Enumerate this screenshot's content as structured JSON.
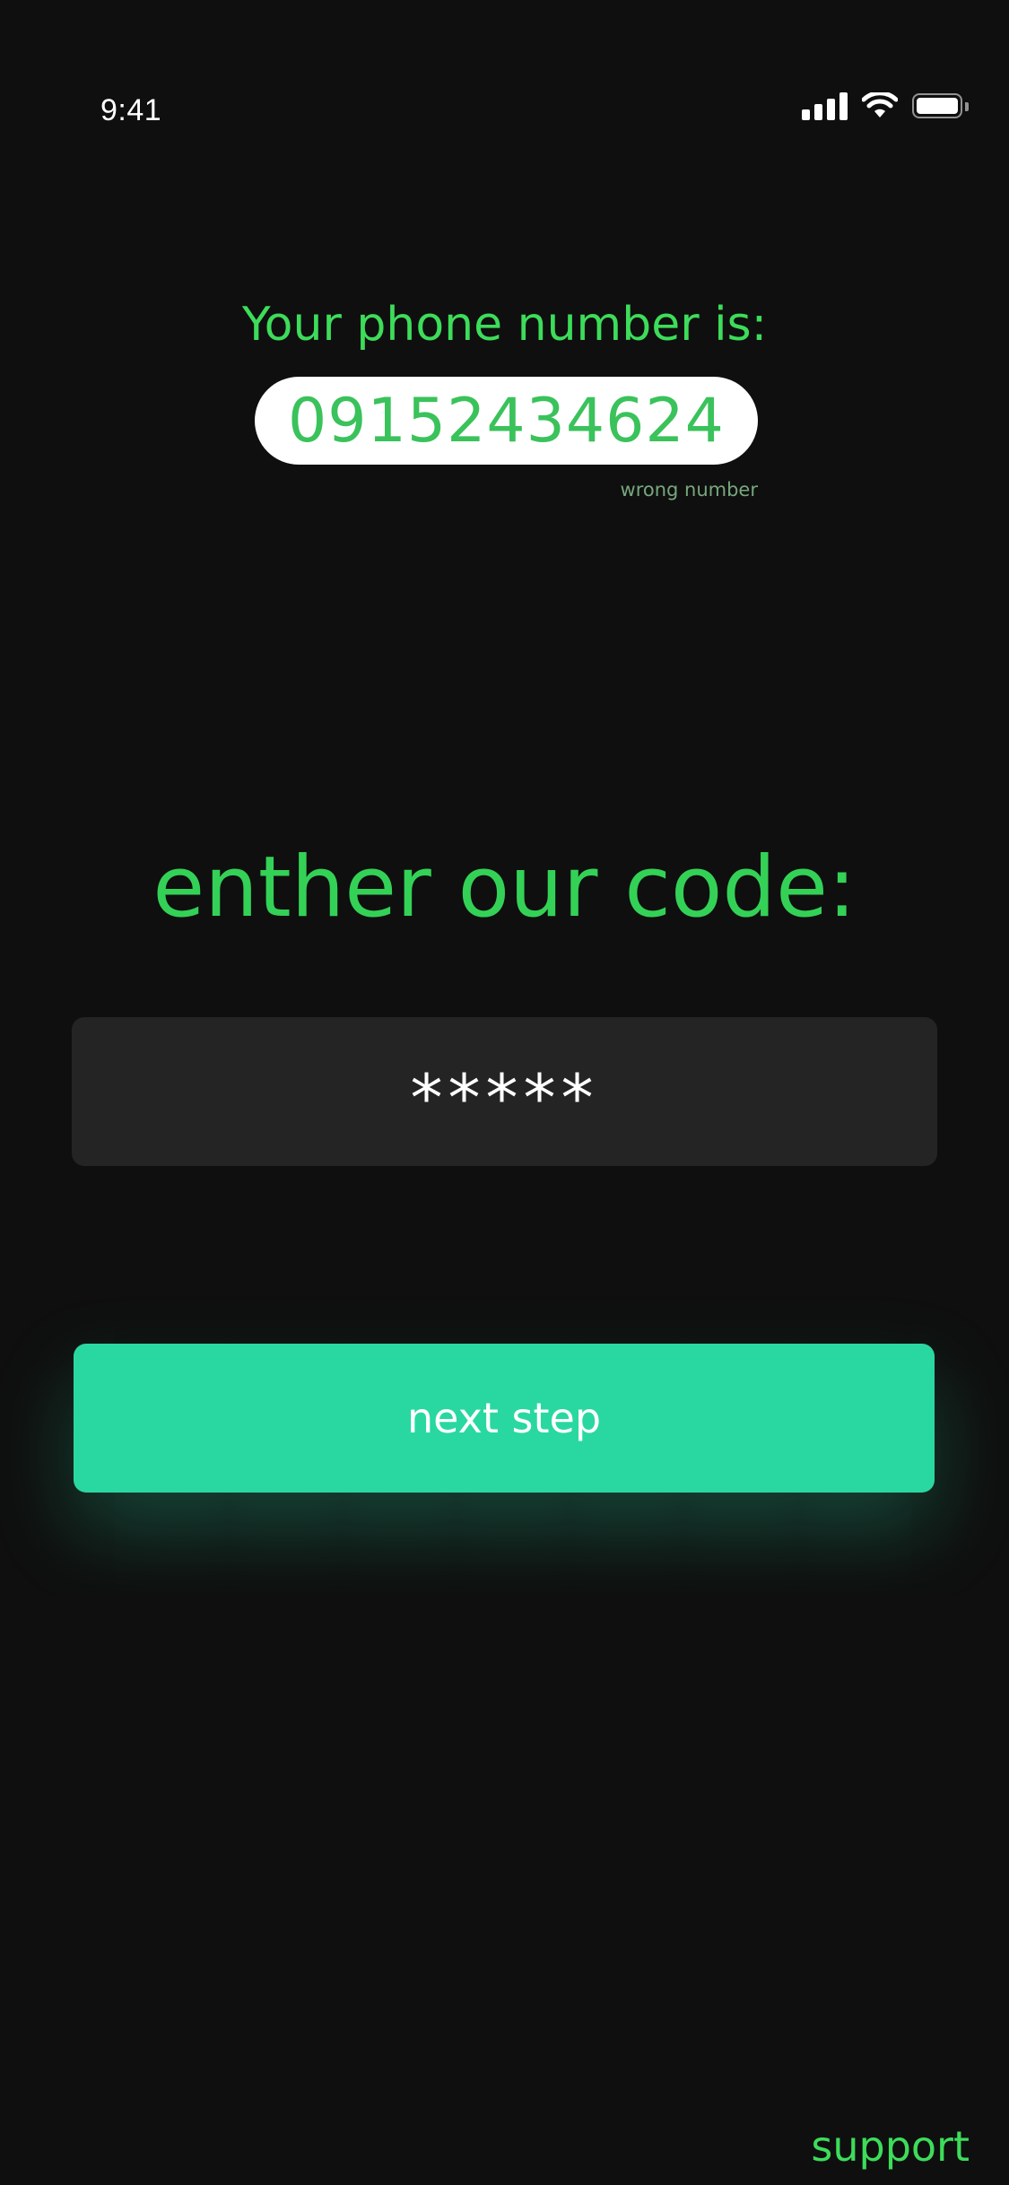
{
  "status_bar": {
    "time": "9:41",
    "icons": [
      "signal-icon",
      "wifi-icon",
      "battery-icon"
    ]
  },
  "phone": {
    "label": "Your phone number is:",
    "number": "09152434624",
    "wrong_number_link": "wrong number"
  },
  "code": {
    "heading": "enther our code:",
    "value": "*****"
  },
  "actions": {
    "next_step_label": "next step",
    "support_label": "support"
  },
  "colors": {
    "background": "#0f0f0f",
    "accent_green": "#3ddc5a",
    "button_teal": "#29d8a0",
    "input_bg": "#242424",
    "pill_bg": "#ffffff"
  }
}
